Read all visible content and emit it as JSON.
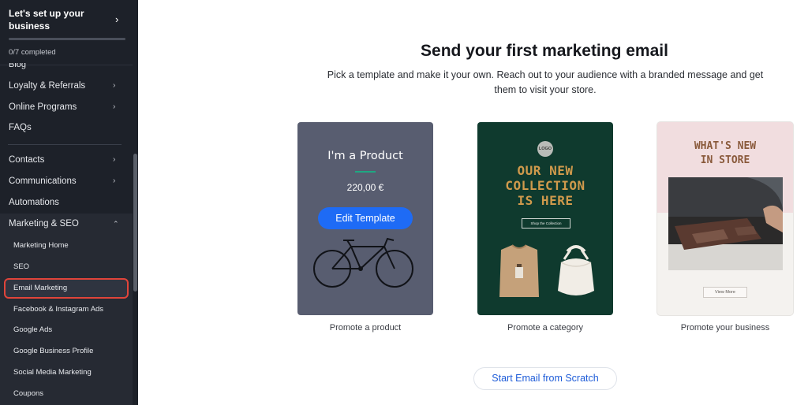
{
  "setup": {
    "title": "Let's set up your business",
    "status": "0/7 completed",
    "progress_fraction": 0.0
  },
  "sidebar": {
    "cut_item": "Blog",
    "items": [
      {
        "label": "Loyalty & Referrals"
      },
      {
        "label": "Online Programs"
      },
      {
        "label": "FAQs"
      },
      {
        "label": "Contacts"
      },
      {
        "label": "Communications"
      },
      {
        "label": "Automations"
      },
      {
        "label": "Marketing & SEO"
      }
    ],
    "sub_items": [
      {
        "label": "Marketing Home"
      },
      {
        "label": "SEO"
      },
      {
        "label": "Email Marketing"
      },
      {
        "label": "Facebook & Instagram Ads"
      },
      {
        "label": "Google Ads"
      },
      {
        "label": "Google Business Profile"
      },
      {
        "label": "Social Media Marketing"
      },
      {
        "label": "Coupons"
      }
    ]
  },
  "main": {
    "title": "Send your first marketing email",
    "subtitle": "Pick a template and make it your own. Reach out to your audience with a branded message and get them to visit your store.",
    "cards": [
      {
        "label": "Promote a product",
        "product_name": "I'm a Product",
        "price": "220,00 €",
        "edit_button": "Edit Template"
      },
      {
        "label": "Promote a category",
        "logo": "LOGO",
        "headline_line1": "OUR NEW",
        "headline_line2": "COLLECTION",
        "headline_line3": "IS HERE",
        "shop_button": "Shop the Collection"
      },
      {
        "label": "Promote your business",
        "headline_line1": "WHAT'S NEW",
        "headline_line2": "IN STORE",
        "view_button": "View More"
      }
    ],
    "scratch_button": "Start Email from Scratch"
  },
  "colors": {
    "sidebar_bg": "#1d2129",
    "accent_blue": "#1e6bf5",
    "active_outline": "#e0443a"
  }
}
